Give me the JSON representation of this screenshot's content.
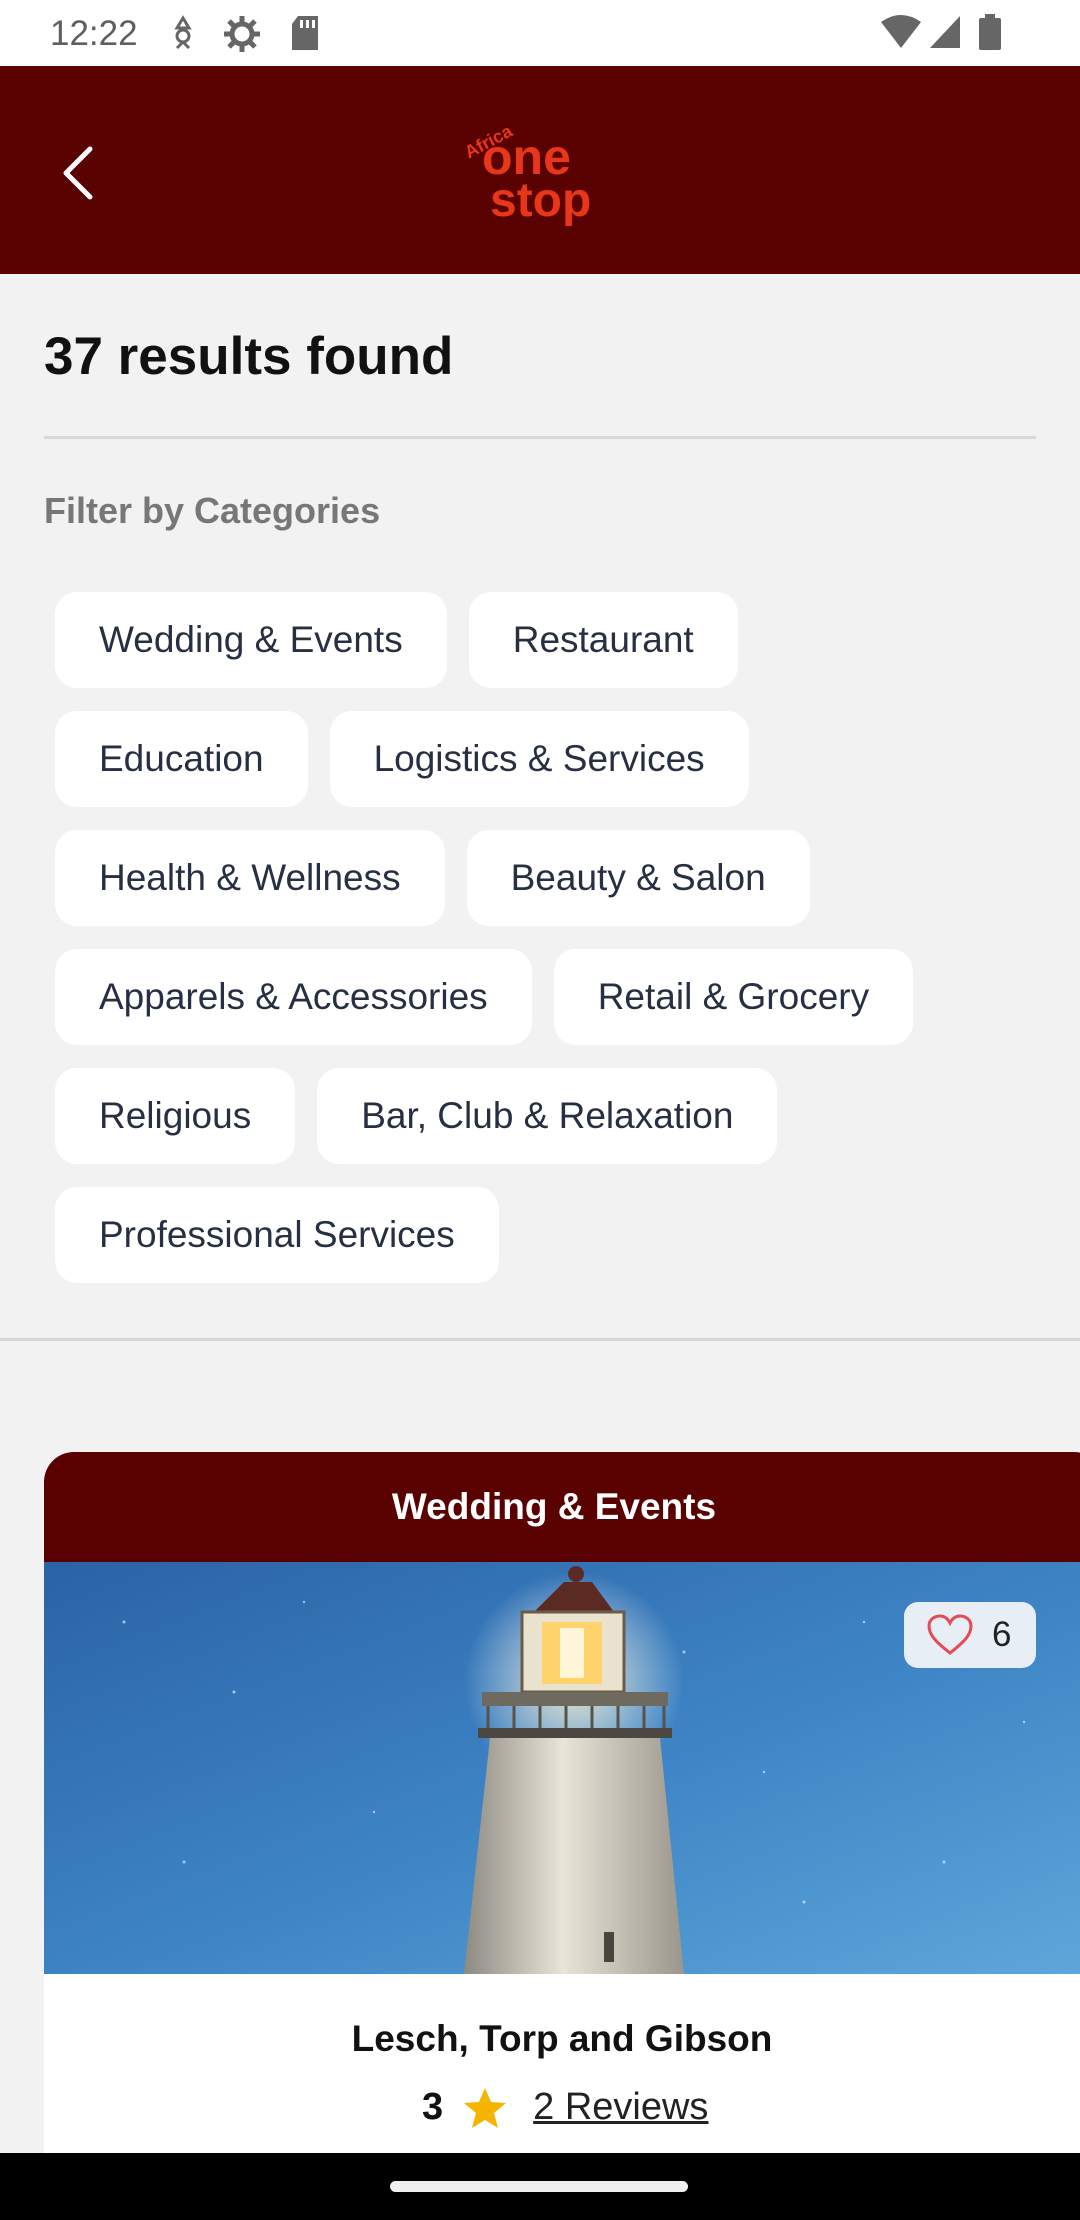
{
  "status_bar": {
    "time": "12:22",
    "left_icons": [
      "debug-icon",
      "settings-icon",
      "sd-card-icon"
    ],
    "right_icons": [
      "wifi-icon",
      "signal-icon",
      "battery-icon"
    ]
  },
  "app_bar": {
    "back_icon": "chevron-left-icon",
    "logo_small": "Africa",
    "logo_main": "one stop",
    "background": "#5a0202",
    "logo_color": "#e8361b"
  },
  "results": {
    "heading": "37 results found"
  },
  "filter": {
    "title": "Filter by Categories",
    "rows": [
      [
        "Wedding & Events",
        "Restaurant"
      ],
      [
        "Education",
        "Logistics & Services"
      ],
      [
        "Health & Wellness",
        "Beauty & Salon"
      ],
      [
        "Apparels & Accessories",
        "Retail & Grocery"
      ],
      [
        "Religious",
        "Bar, Club & Relaxation"
      ],
      [
        "Professional Services"
      ]
    ]
  },
  "listing": {
    "category": "Wedding & Events",
    "likes": "6",
    "name": "Lesch, Torp and Gibson",
    "rating": "3",
    "reviews": "2 Reviews",
    "star_color": "#f5b400"
  }
}
